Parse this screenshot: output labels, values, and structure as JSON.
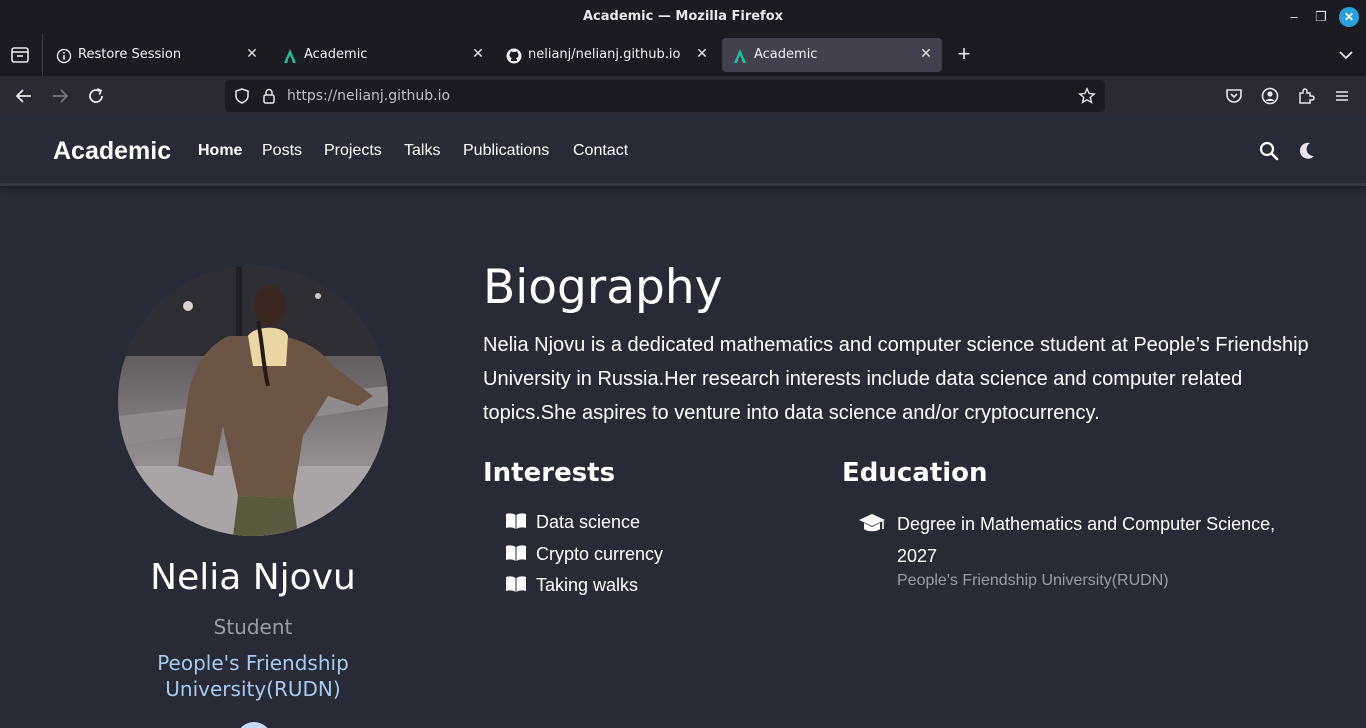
{
  "window": {
    "title": "Academic — Mozilla Firefox",
    "minimize_glyph": "–",
    "maximize_glyph": "❐",
    "close_glyph": "✕"
  },
  "tabs": [
    {
      "label": "Restore Session",
      "icon": "info-icon",
      "active": false
    },
    {
      "label": "Academic",
      "icon": "academic-logo-icon",
      "active": false
    },
    {
      "label": "nelianj/nelianj.github.io",
      "icon": "github-icon",
      "active": false
    },
    {
      "label": "Academic",
      "icon": "academic-logo-icon",
      "active": true
    }
  ],
  "tab_close_glyph": "✕",
  "new_tab_glyph": "+",
  "urlbar": {
    "url": "https://nelianj.github.io"
  },
  "site": {
    "brand": "Academic",
    "nav": [
      "Home",
      "Posts",
      "Projects",
      "Talks",
      "Publications",
      "Contact"
    ],
    "active_nav": "Home"
  },
  "profile": {
    "name": "Nelia Njovu",
    "role": "Student",
    "organization": "People's Friendship University(RUDN)"
  },
  "biography": {
    "title": "Biography",
    "text": "Nelia Njovu is a dedicated mathematics and computer science student at People’s Friendship University in Russia.Her research interests include data science and computer related topics.She aspires to venture into data science and/or cryptocurrency."
  },
  "interests": {
    "title": "Interests",
    "items": [
      "Data science",
      "Crypto currency",
      "Taking walks"
    ]
  },
  "education": {
    "title": "Education",
    "items": [
      {
        "degree": "Degree in Mathematics and Computer Science, 2027",
        "institution": "People's Friendship University(RUDN)"
      }
    ]
  },
  "colors": {
    "page_bg": "#282a36",
    "org_link": "#a9c9f0",
    "muted_text": "#9b9ba6",
    "chrome_dark": "#1c1b22",
    "chrome_toolbar": "#2b2a33",
    "active_tab": "#42414d",
    "close_button": "#2aa1dc",
    "academic_logo": "#1ec09f"
  }
}
